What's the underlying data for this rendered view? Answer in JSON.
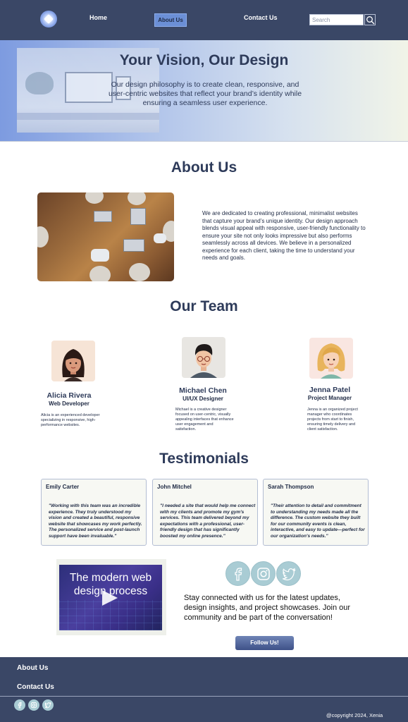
{
  "nav": {
    "logo_icon": "diamond-star-icon",
    "links": [
      "Home",
      "About Us",
      "Contact Us"
    ],
    "active": "About Us",
    "search_placeholder": "Search",
    "search_icon": "search-icon"
  },
  "hero": {
    "title": "Your Vision, Our Design",
    "text": "Our design philosophy is to create clean, responsive, and user-centric websites that reflect your brand’s identity while ensuring a seamless user experience."
  },
  "about": {
    "title": "About Us",
    "text": "We are dedicated to creating professional, minimalist websites that capture your brand’s unique identity. Our design approach blends visual appeal with responsive, user-friendly functionality to ensure your site not only looks impressive but also performs seamlessly across all devices. We believe in a personalized experience for each client, taking the time to understand your needs and goals."
  },
  "team": {
    "title": "Our Team",
    "members": [
      {
        "name": "Alicia Rivera",
        "role": "Web Developer",
        "bio": "Alicia is an experienced developer specializing in responsive, high-performance websites."
      },
      {
        "name": "Michael Chen",
        "role": "UI/UX Designer",
        "bio": "Michael is a creative designer focused on user-centric, visually appealing interfaces that enhance user engagement and satisfaction."
      },
      {
        "name": "Jenna Patel",
        "role": "Project Manager",
        "bio": "Jenna is an organized project manager who coordinates projects from start to finish, ensuring timely delivery and client satisfaction."
      }
    ]
  },
  "testimonials": {
    "title": "Testimonials",
    "items": [
      {
        "name": "Emily Carter",
        "quote": "\"Working with this team was an incredible experience. They truly understood my vision and created a beautiful, responsive website that showcases my work perfectly. The personalized service and post-launch support have been invaluable.\""
      },
      {
        "name": "John Mitchel",
        "quote": "\"I needed a site that would help me connect with my clients and promote my gym's services. This team delivered beyond my expectations with a professional, user-friendly design that has significantly boosted my online presence.\""
      },
      {
        "name": "Sarah Thompson",
        "quote": "\"Their attention to detail and commitment to understanding my needs made all the difference. The custom website they built for our community events is clean, interactive, and easy to update—perfect for our organization's needs.\""
      }
    ]
  },
  "video": {
    "title": "The modern web design process",
    "play_icon": "play-icon"
  },
  "social": {
    "icons": [
      "facebook-icon",
      "instagram-icon",
      "twitter-icon"
    ],
    "text": "Stay connected with us for the latest updates, design insights, and project showcases. Join our community and be part of the conversation!",
    "button": "Follow Us!"
  },
  "footer": {
    "links": [
      "About Us",
      "Contact Us"
    ],
    "copyright": "@copyright 2024, Xenia"
  },
  "colors": {
    "nav_bg": "#3a4766",
    "accent": "#6b8fd6",
    "heading": "#2e3b5a",
    "social_bg": "#a9ccd4"
  }
}
